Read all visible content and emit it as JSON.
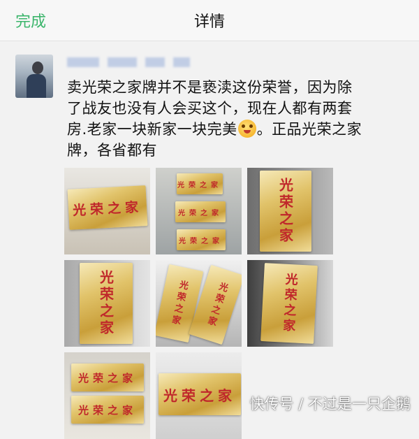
{
  "nav": {
    "done_label": "完成",
    "title": "详情"
  },
  "post": {
    "lines": [
      "卖光荣之家牌并不是亵渎这份荣誉，因为除",
      "了战友也没有人会买这个，现在人都有两套",
      "房.老家一块新家一块完美",
      "。正品光荣之家",
      "牌，各省都有"
    ],
    "emoji_icon": "grinning-face-emoji"
  },
  "plaque_text": "光荣之家",
  "watermark": "快传号 / 不过是一只企鹅"
}
